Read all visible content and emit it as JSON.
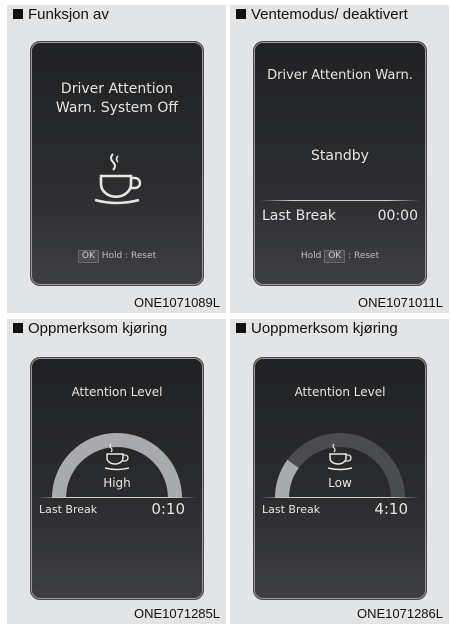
{
  "panels": [
    {
      "heading": "Funksjon av",
      "screen_title": "Driver Attention Warn. System Off",
      "hint_ok": "OK",
      "hint_text": "Hold : Reset",
      "code": "ONE1071089L"
    },
    {
      "heading": "Ventemodus/ deaktivert",
      "screen_title": "Driver Attention Warn.",
      "status": "Standby",
      "last_break_label": "Last Break",
      "last_break_value": "00:00",
      "hint_prefix": "Hold",
      "hint_ok": "OK",
      "hint_suffix": ": Reset",
      "code": "ONE1071011L"
    },
    {
      "heading": "Oppmerksom kjøring",
      "screen_title": "Attention Level",
      "level_label": "High",
      "level_fraction": 1.0,
      "last_break_label": "Last Break",
      "last_break_value": "0:10",
      "code": "ONE1071285L"
    },
    {
      "heading": "Uoppmerksom kjøring",
      "screen_title": "Attention Level",
      "level_label": "Low",
      "level_fraction": 0.2,
      "last_break_label": "Last Break",
      "last_break_value": "4:10",
      "code": "ONE1071286L"
    }
  ],
  "icons": [
    "coffee-cup-icon"
  ],
  "colors": {
    "screen_bg": "#26272a",
    "gauge_active": "#a9aaab",
    "gauge_inactive": "#4b4c4e",
    "panel_bg": "#e3e4e5"
  }
}
